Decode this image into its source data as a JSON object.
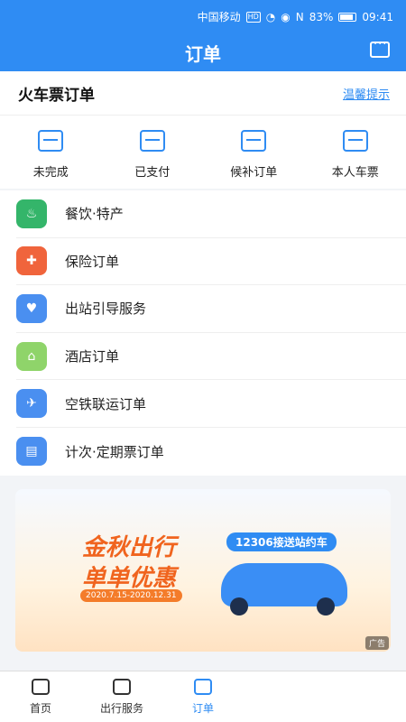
{
  "status": {
    "carrier": "中国移动",
    "battery": "83%",
    "time": "09:41"
  },
  "header": {
    "title": "订单"
  },
  "section": {
    "title": "火车票订单",
    "tip": "温馨提示"
  },
  "quick": [
    {
      "label": "未完成"
    },
    {
      "label": "已支付"
    },
    {
      "label": "候补订单"
    },
    {
      "label": "本人车票"
    }
  ],
  "list": [
    {
      "label": "餐饮·特产",
      "color": "#34b56a"
    },
    {
      "label": "保险订单",
      "color": "#f0643c"
    },
    {
      "label": "出站引导服务",
      "color": "#4a8ff0"
    },
    {
      "label": "酒店订单",
      "color": "#8fd46a"
    },
    {
      "label": "空铁联运订单",
      "color": "#4a8ff0"
    },
    {
      "label": "计次·定期票订单",
      "color": "#4a8ff0"
    }
  ],
  "banner": {
    "line1": "金秋出行",
    "line2": "单单优惠",
    "date": "2020.7.15-2020.12.31",
    "badge": "12306接送站约车",
    "ad": "广告"
  },
  "tabs": [
    {
      "label": "首页"
    },
    {
      "label": "出行服务"
    },
    {
      "label": "订单"
    }
  ]
}
